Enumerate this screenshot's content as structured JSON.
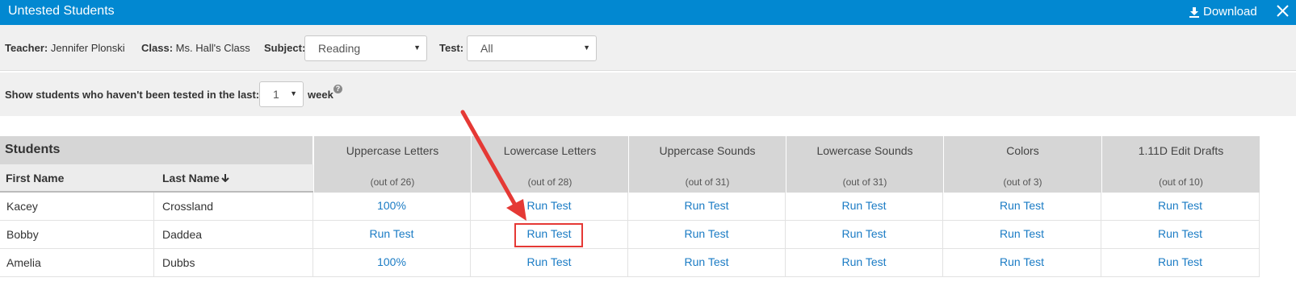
{
  "window": {
    "title": "Untested Students",
    "download_label": "Download"
  },
  "filters": {
    "teacher_label": "Teacher:",
    "teacher_value": "Jennifer Plonski",
    "class_label": "Class:",
    "class_value": "Ms. Hall's Class",
    "subject_label": "Subject:",
    "subject_value": "Reading",
    "test_label": "Test:",
    "test_value": "All"
  },
  "untested": {
    "prefix": "Show students who haven't been tested in the last:",
    "value": "1",
    "suffix": "week",
    "help": "?"
  },
  "table": {
    "title": "Students",
    "first_name_header": "First Name",
    "last_name_header": "Last Name",
    "sort_icon": "arrow-down-icon",
    "columns": [
      {
        "name": "Uppercase Letters",
        "out_of": "(out of 26)"
      },
      {
        "name": "Lowercase Letters",
        "out_of": "(out of 28)"
      },
      {
        "name": "Uppercase Sounds",
        "out_of": "(out of 31)"
      },
      {
        "name": "Lowercase Sounds",
        "out_of": "(out of 31)"
      },
      {
        "name": "Colors",
        "out_of": "(out of 3)"
      },
      {
        "name": "1.11D Edit Drafts",
        "out_of": "(out of 10)"
      }
    ],
    "rows": [
      {
        "first": "Kacey",
        "last": "Crossland",
        "cells": [
          "100%",
          "Run Test",
          "Run Test",
          "Run Test",
          "Run Test",
          "Run Test"
        ]
      },
      {
        "first": "Bobby",
        "last": "Daddea",
        "cells": [
          "Run Test",
          "Run Test",
          "Run Test",
          "Run Test",
          "Run Test",
          "Run Test"
        ]
      },
      {
        "first": "Amelia",
        "last": "Dubbs",
        "cells": [
          "100%",
          "Run Test",
          "Run Test",
          "Run Test",
          "Run Test",
          "Run Test"
        ]
      }
    ]
  },
  "colors": {
    "title_bar": "#0288d1",
    "link": "#1a7bc4",
    "annotation": "#e53935"
  }
}
